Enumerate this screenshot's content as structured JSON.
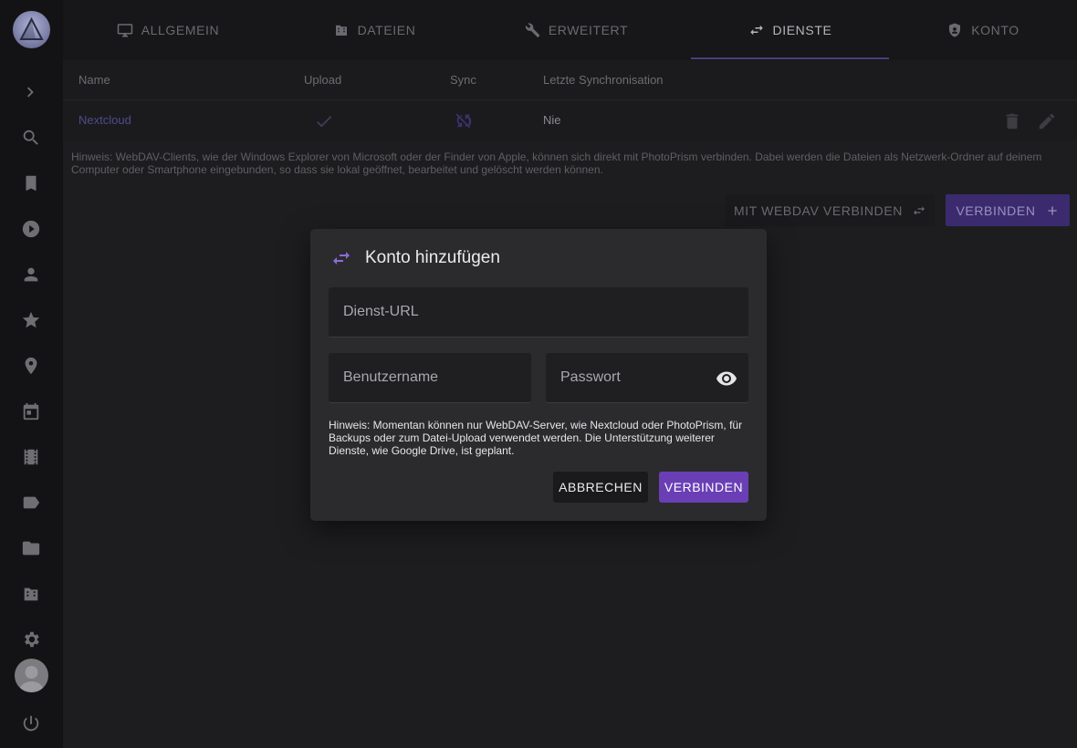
{
  "tabs": [
    {
      "label": "ALLGEMEIN",
      "icon": "monitor-icon"
    },
    {
      "label": "DATEIEN",
      "icon": "film-folder-icon"
    },
    {
      "label": "ERWEITERT",
      "icon": "wrench-icon"
    },
    {
      "label": "DIENSTE",
      "icon": "swap-icon",
      "active": true
    },
    {
      "label": "KONTO",
      "icon": "account-icon"
    }
  ],
  "sidebar": {
    "icons": [
      "chevron-right-icon",
      "search-icon",
      "bookmark-icon",
      "play-icon",
      "person-icon",
      "star-icon",
      "location-pin-icon",
      "calendar-icon",
      "film-icon",
      "label-icon",
      "folder-icon",
      "film-folder-icon",
      "gear-icon",
      "avatar",
      "power-icon"
    ]
  },
  "table": {
    "headers": {
      "name": "Name",
      "upload": "Upload",
      "sync": "Sync",
      "last": "Letzte Synchronisation"
    },
    "rows": [
      {
        "name": "Nextcloud",
        "upload": "check-icon",
        "sync": "sync-disabled-icon",
        "last": "Nie"
      }
    ]
  },
  "page": {
    "note": "Hinweis: WebDAV-Clients, wie der Windows Explorer von Microsoft oder der Finder von Apple, können sich direkt mit PhotoPrism verbinden. Dabei werden die Dateien als Netzwerk-Ordner auf deinem Computer oder Smartphone eingebunden, so dass sie lokal geöffnet, bearbeitet und gelöscht werden können.",
    "webdav_button": "MIT WEBDAV VERBINDEN",
    "connect_button": "VERBINDEN"
  },
  "dialog": {
    "title": "Konto hinzufügen",
    "url_placeholder": "Dienst-URL",
    "user_placeholder": "Benutzername",
    "password_placeholder": "Passwort",
    "note": "Hinweis: Momentan können nur WebDAV-Server, wie Nextcloud oder PhotoPrism, für Backups oder zum Datei-Upload verwendet werden. Die Unterstützung weiterer Dienste, wie Google Drive, ist geplant.",
    "cancel": "ABBRECHEN",
    "confirm": "VERBINDEN"
  },
  "colors": {
    "accent": "#6a3fb5",
    "accent_dark": "#3b2b6e",
    "background": "#1d1d1f",
    "sidebar": "#131315",
    "dialog": "#2b2b2e"
  }
}
